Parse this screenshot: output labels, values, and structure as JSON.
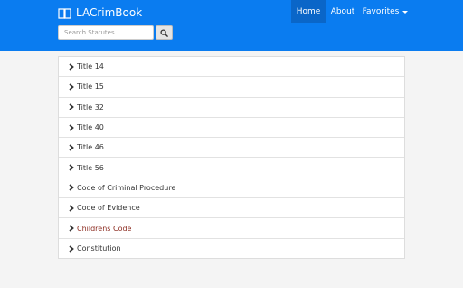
{
  "navbar": {
    "brand": "LACrimBook",
    "items": [
      {
        "label": "Home",
        "active": true
      },
      {
        "label": "About",
        "active": false
      },
      {
        "label": "Favorites",
        "active": false,
        "dropdown": true
      }
    ]
  },
  "search": {
    "placeholder": "Search Statutes",
    "button_icon": "search-icon"
  },
  "list": {
    "items": [
      {
        "label": "Title 14"
      },
      {
        "label": "Title 15"
      },
      {
        "label": "Title 32"
      },
      {
        "label": "Title 40"
      },
      {
        "label": "Title 46"
      },
      {
        "label": "Title 56"
      },
      {
        "label": "Code of Criminal Procedure"
      },
      {
        "label": "Code of Evidence"
      },
      {
        "label": "Childrens Code"
      },
      {
        "label": "Constitution"
      }
    ]
  },
  "colors": {
    "navbar": "#0a7cf0",
    "nav_active": "#0a66c8",
    "link_item": "#8b2a1f"
  }
}
